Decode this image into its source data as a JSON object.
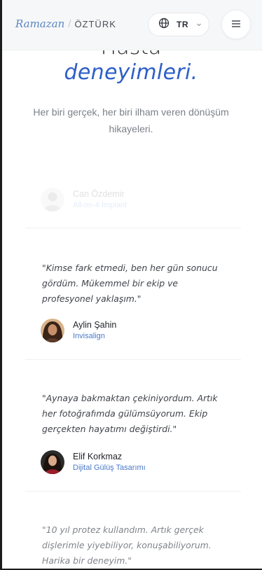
{
  "header": {
    "brand_first": "Ramazan",
    "brand_sep": "/",
    "brand_last": "ÖZTÜRK",
    "language_code": "TR",
    "globe_icon": "globe-icon",
    "chevron_icon": "chevron-down-icon",
    "menu_icon": "hamburger-menu-icon"
  },
  "hero": {
    "heading_top": "Hasta",
    "heading_accent": "deneyimleri.",
    "subtitle": "Her biri gerçek, her biri ilham veren dönüşüm hikayeleri."
  },
  "testimonials": [
    {
      "name": "Can Özdemir",
      "treatment": "All-on-4 İmplant"
    },
    {
      "quote": "\"Kimse fark etmedi, ben her gün sonucu gördüm. Mükemmel bir ekip ve profesyonel yaklaşım.\"",
      "name": "Aylin Şahin",
      "treatment": "Invisalign"
    },
    {
      "quote": "\"Aynaya bakmaktan çekiniyordum. Artık her fotoğrafımda gülümsüyorum. Ekip gerçekten hayatımı değiştirdi.\"",
      "name": "Elif Korkmaz",
      "treatment": "Dijital Gülüş Tasarımı"
    },
    {
      "quote": "\"10 yıl protez kullandım. Artık gerçek dişlerimle yiyebiliyor, konuşabiliyorum. Harika bir deneyim.\""
    }
  ],
  "colors": {
    "accent": "#2d5fc7",
    "brand_blue": "#5b86c2",
    "tag_blue": "#4a79c9",
    "header_bg": "#f6f7f8",
    "text_muted": "#7b8089"
  }
}
